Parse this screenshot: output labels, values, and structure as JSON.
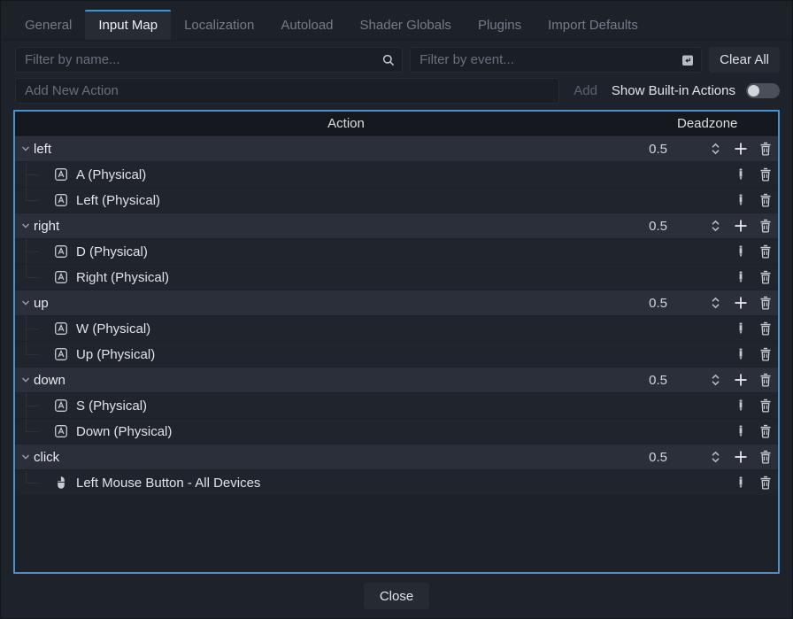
{
  "tabs": [
    {
      "label": "General",
      "active": false
    },
    {
      "label": "Input Map",
      "active": true
    },
    {
      "label": "Localization",
      "active": false
    },
    {
      "label": "Autoload",
      "active": false
    },
    {
      "label": "Shader Globals",
      "active": false
    },
    {
      "label": "Plugins",
      "active": false
    },
    {
      "label": "Import Defaults",
      "active": false
    }
  ],
  "filters": {
    "name_placeholder": "Filter by name...",
    "event_placeholder": "Filter by event...",
    "clear_all_label": "Clear All"
  },
  "add_row": {
    "placeholder": "Add New Action",
    "add_label": "Add",
    "add_enabled": false,
    "show_builtin_label": "Show Built-in Actions",
    "show_builtin_toggle": "off"
  },
  "table": {
    "headers": {
      "action": "Action",
      "deadzone": "Deadzone"
    },
    "actions": [
      {
        "name": "left",
        "deadzone": "0.5",
        "events": [
          {
            "icon": "keyboard-icon",
            "label": "A (Physical)"
          },
          {
            "icon": "keyboard-icon",
            "label": "Left (Physical)"
          }
        ]
      },
      {
        "name": "right",
        "deadzone": "0.5",
        "events": [
          {
            "icon": "keyboard-icon",
            "label": "D (Physical)"
          },
          {
            "icon": "keyboard-icon",
            "label": "Right (Physical)"
          }
        ]
      },
      {
        "name": "up",
        "deadzone": "0.5",
        "events": [
          {
            "icon": "keyboard-icon",
            "label": "W (Physical)"
          },
          {
            "icon": "keyboard-icon",
            "label": "Up (Physical)"
          }
        ]
      },
      {
        "name": "down",
        "deadzone": "0.5",
        "events": [
          {
            "icon": "keyboard-icon",
            "label": "S (Physical)"
          },
          {
            "icon": "keyboard-icon",
            "label": "Down (Physical)"
          }
        ]
      },
      {
        "name": "click",
        "deadzone": "0.5",
        "events": [
          {
            "icon": "mouse-icon",
            "label": "Left Mouse Button - All Devices"
          }
        ]
      }
    ]
  },
  "footer": {
    "close_label": "Close"
  },
  "colors": {
    "panel_border": "#4e8ec9",
    "tab_accent": "#3c94da",
    "action_row_bg": "#2a2f39",
    "event_row_bg": "#20242d",
    "icon_color": "#c6cbd2"
  }
}
